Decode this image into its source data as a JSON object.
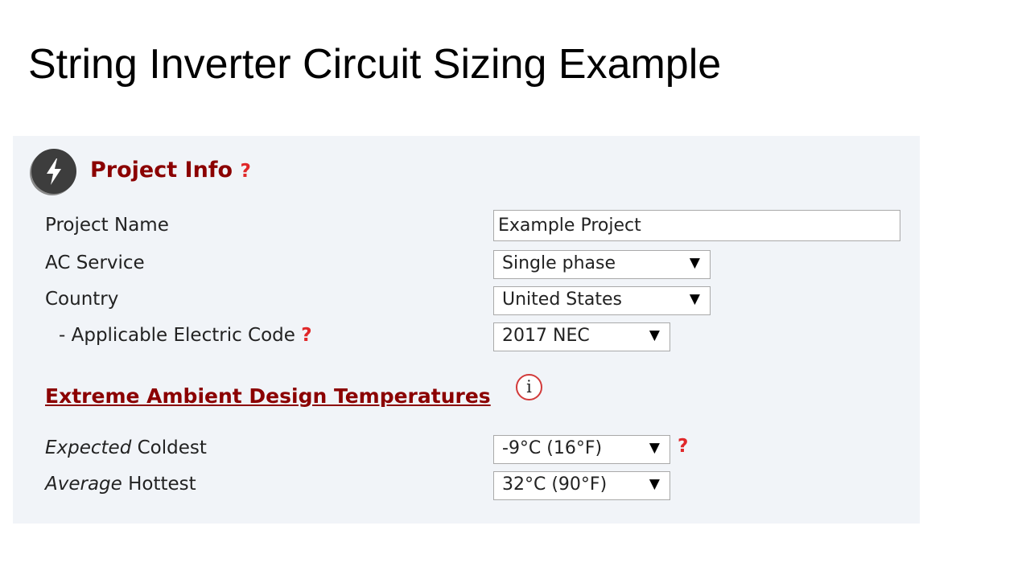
{
  "slide": {
    "title": "String Inverter Circuit Sizing Example"
  },
  "section": {
    "title": "Project Info",
    "help_glyph": "?"
  },
  "fields": {
    "project_name": {
      "label": "Project Name",
      "value": "Example Project"
    },
    "ac_service": {
      "label": "AC Service",
      "value": "Single phase"
    },
    "country": {
      "label": "Country",
      "value": "United States"
    },
    "electric_code": {
      "label": "- Applicable Electric Code",
      "value": "2017 NEC",
      "help_glyph": "?"
    }
  },
  "temperatures": {
    "title": "Extreme Ambient Design Temperatures",
    "info_glyph": "i",
    "coldest": {
      "label_em": "Expected",
      "label_rest": " Coldest",
      "value": "-9°C (16°F)",
      "help_glyph": "?"
    },
    "hottest": {
      "label_em": "Average",
      "label_rest": " Hottest",
      "value": "32°C (90°F)"
    }
  },
  "dropdown_arrow": "▼",
  "colors": {
    "section_title": "#8b0000",
    "help": "#e0282a",
    "panel_bg": "#f1f4f8",
    "logo_bg": "#3d3d3d"
  },
  "icons": {
    "logo": "lightning-bolt-icon",
    "info": "info-icon",
    "help": "question-mark-icon"
  }
}
